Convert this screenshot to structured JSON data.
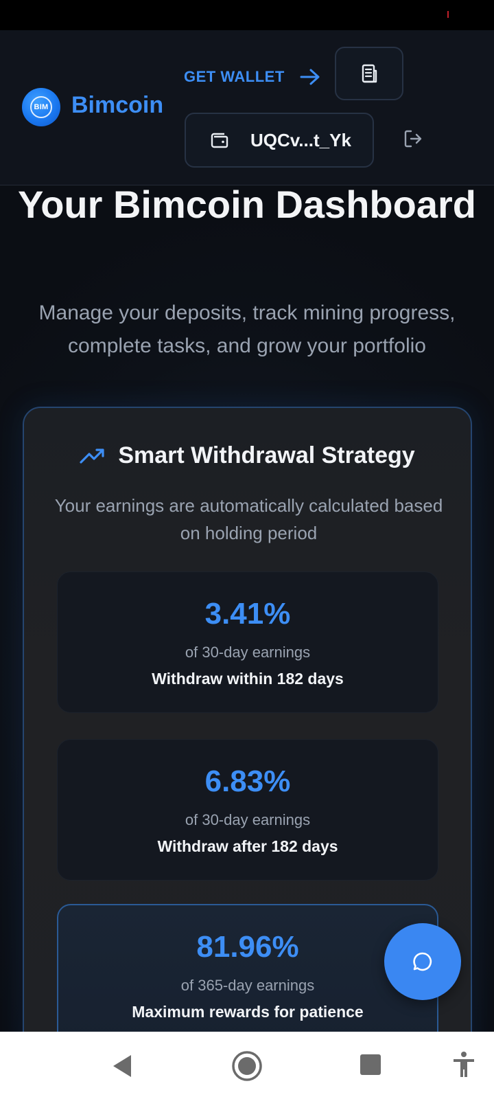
{
  "header": {
    "logo_text": "BIM",
    "brand": "Bimcoin",
    "get_wallet": "GET WALLET",
    "wallet_address": "UQCv...t_Yk"
  },
  "hero": {
    "title": "Your Bimcoin Dashboard",
    "subtitle": "Manage your deposits, track mining progress, complete tasks, and grow your portfolio"
  },
  "strategy": {
    "title": "Smart Withdrawal Strategy",
    "description": "Your earnings are automatically calculated based on holding period",
    "tiers": [
      {
        "percent": "3.41%",
        "label": "of 30-day earnings",
        "note": "Withdraw within 182 days"
      },
      {
        "percent": "6.83%",
        "label": "of 30-day earnings",
        "note": "Withdraw after 182 days"
      },
      {
        "percent": "81.96%",
        "label": "of 365-day earnings",
        "note": "Maximum rewards for patience"
      }
    ]
  },
  "colors": {
    "accent": "#3d8ef5",
    "background": "#0c0f16",
    "card_border": "#25456f"
  },
  "icons": {
    "arrow": "arrow-right-icon",
    "book": "document-icon",
    "wallet": "wallet-icon",
    "logout": "logout-icon",
    "trend": "trending-up-icon",
    "chat": "chat-icon"
  }
}
